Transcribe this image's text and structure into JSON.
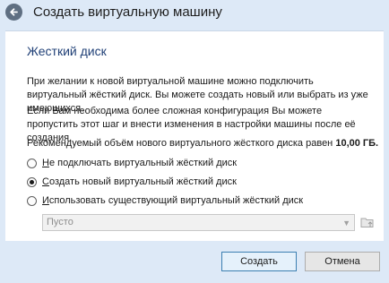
{
  "window": {
    "title": "Создать виртуальную машину"
  },
  "section": {
    "title": "Жесткий диск"
  },
  "text": {
    "p1": "При желании к новой виртуальной машине можно подключить виртуальный жёсткий диск. Вы можете создать новый или выбрать из уже имеющихся.",
    "p2": "Если Вам необходима более сложная конфигурация Вы можете пропустить этот шаг и внести изменения в настройки машины после её создания.",
    "p3_prefix": "Рекомендуемый объём нового виртуального жёсткого диска равен",
    "p3_size": "10,00 ГБ."
  },
  "options": [
    {
      "accel": "Н",
      "rest": "е подключать виртуальный жёсткий диск",
      "checked": false
    },
    {
      "accel": "С",
      "rest": "оздать новый виртуальный жёсткий диск",
      "checked": true
    },
    {
      "accel": "И",
      "rest": "спользовать существующий виртуальный жёсткий диск",
      "checked": false
    }
  ],
  "disk_select": {
    "value": "Пусто",
    "enabled": false
  },
  "buttons": {
    "create": "Создать",
    "cancel": "Отмена"
  }
}
